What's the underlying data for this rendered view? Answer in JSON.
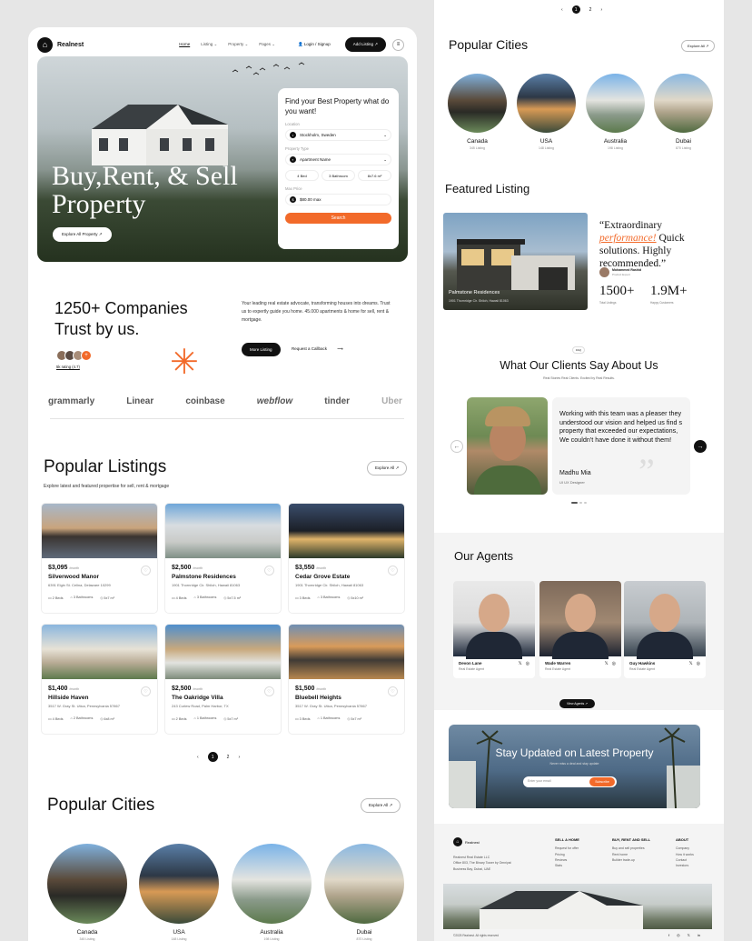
{
  "nav": {
    "brand": "Realnest",
    "menu": [
      "Home",
      "Listing ⌄",
      "Property ⌄",
      "Pages ⌄"
    ],
    "login": "Login / Signup",
    "add_listing": "Add Listing ↗"
  },
  "hero": {
    "title_line1": "Buy,Rent, & Sell",
    "title_line2": "Property",
    "button": "Explore All Property ↗",
    "search": {
      "heading": "Find your Best Property what do you want!",
      "location_label": "Location",
      "location_value": "Stockholm, Sweden",
      "type_label": "Property Type",
      "type_value": "Apartment Name",
      "beds": "4 Bed",
      "baths": "3 Bathroom",
      "area": "8x7.6 m²",
      "price_label": "Max Price",
      "price_value": "$80.00 max",
      "search_button": "Search"
    }
  },
  "trust": {
    "title_line1": "1250+ Companies",
    "title_line2": "Trust by us.",
    "rating": "5k rating (4.7)",
    "description": "Your leading real estate advocate, transforming houses into dreams. Trust us to expertly guide you home. 45.000 apartments & home for sell, rent & mortgage.",
    "more_button": "More Listing",
    "callback": "Request a Callback",
    "brands": [
      "grammarly",
      "Linear",
      "coinbase",
      "webflow",
      "tinder",
      "Uber"
    ]
  },
  "listings": {
    "title": "Popular Listings",
    "subtitle": "Explore latest and featured propertise for sell, rent & mortgage",
    "explore": "Explore All ↗",
    "per_month": "/month",
    "items": [
      {
        "price": "$3,095",
        "name": "Silverwood Manor",
        "address": "6391 Elgin St. Celina, Delaware 10299",
        "beds": "2 Beds",
        "baths": "3 Bathrooms",
        "area": "5x7 m²"
      },
      {
        "price": "$2,500",
        "name": "Palmstone Residences",
        "address": "1901 Thornridge Cir. Shiloh, Hawaii 81063",
        "beds": "4 Beds",
        "baths": "3 Bathrooms",
        "area": "5x7.5 m²"
      },
      {
        "price": "$3,550",
        "name": "Cedar Grove Estate",
        "address": "1901 Thornridge Cir. Shiloh, Hawaii 81063",
        "beds": "3 Beds",
        "baths": "3 Bathrooms",
        "area": "5x10 m²"
      },
      {
        "price": "$1,400",
        "name": "Hillside Haven",
        "address": "3517 W. Gray St. Utica, Pennsylvania 57867",
        "beds": "4 Beds",
        "baths": "2 Bathrooms",
        "area": "6x8 m²"
      },
      {
        "price": "$2,500",
        "name": "The Oakridge Villa",
        "address": "243 Curlew Road, Palm Harbor, TX",
        "beds": "2 Beds",
        "baths": "1 Bathrooms",
        "area": "5x7 m²"
      },
      {
        "price": "$1,500",
        "name": "Bluebell Heights",
        "address": "3517 W. Gray St. Utica, Pennsylvania 57867",
        "beds": "3 Beds",
        "baths": "1 Bathrooms",
        "area": "5x7 m²"
      }
    ],
    "pages": [
      "‹",
      "1",
      "2",
      "›"
    ]
  },
  "cities": {
    "title": "Popular Cities",
    "explore": "Explore All ↗",
    "items": [
      {
        "name": "Canada",
        "count": "345 Listing"
      },
      {
        "name": "USA",
        "count": "148 Listing"
      },
      {
        "name": "Australia",
        "count": "198 Listing"
      },
      {
        "name": "Dubai",
        "count": "870 Listing"
      }
    ]
  },
  "featured": {
    "title": "Featured Listing",
    "property_name": "Palmstone Residences",
    "property_address": "1901 Thornridge Cir. Shiloh, Hawaii 81063",
    "quote_open": "“Extraordinary ",
    "quote_highlight": "performance!",
    "quote_rest": " Quick solutions. Highly recommended.”",
    "person_name": "Mohammed Rashid",
    "person_role": "Product Expert",
    "stat1_value": "1500+",
    "stat1_label": "Total Listings",
    "stat2_value": "1.9M+",
    "stat2_label": "Happy Customers"
  },
  "testimonials": {
    "badge": "FAQ",
    "title": "What Our Clients Say About Us",
    "subtitle": "Real Stories Real Clients. Excited by Real Results.",
    "text": "Working with this team was a pleaser they understood our vision and helped us find s property that exceeded our expectations, We couldn't have done it without them!",
    "name": "Madhu Mia",
    "role": "UI UX Designer"
  },
  "agents": {
    "title": "Our Agents",
    "items": [
      {
        "name": "Devon Lane",
        "role": "Real Estate Agent"
      },
      {
        "name": "Wade Warren",
        "role": "Real Estate Agent"
      },
      {
        "name": "Guy Hawkins",
        "role": "Real Estate Agent"
      }
    ],
    "button": "View Agents ↗"
  },
  "newsletter": {
    "title": "Stay Updated on Latest Property",
    "subtitle": "Never miss a deal and stay update",
    "placeholder": "Enter your email",
    "button": "Subscribe"
  },
  "footer": {
    "brand": "Realnest",
    "address_lines": [
      "Realnest Real Estate LLC",
      "Office 803, The Binary Tower by Omniyat",
      "Business Bay, Dubai, UAE"
    ],
    "col1_title": "SELL A HOME",
    "col1": [
      "Request for offer",
      "Pricing",
      "Reviews",
      "Stats"
    ],
    "col2_title": "BUY, RENT AND SELL",
    "col2": [
      "Buy and sell properties",
      "Rent home",
      "Builder trade-up"
    ],
    "col3_title": "ABOUT",
    "col3": [
      "Company",
      "How it works",
      "Contact",
      "Investors"
    ],
    "copyright": "©2025 Realnest. All rights reserved"
  },
  "colors": {
    "accent": "#f26a2a",
    "dark": "#111111"
  }
}
